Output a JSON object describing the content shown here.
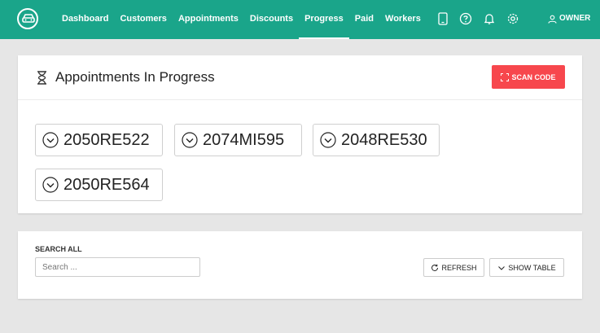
{
  "nav": {
    "links": [
      "Dashboard",
      "Customers",
      "Appointments",
      "Discounts",
      "Progress",
      "Paid",
      "Workers"
    ],
    "active": "Progress",
    "user_label": "OWNER",
    "icons": [
      "tablet-icon",
      "help-icon",
      "bell-icon",
      "gear-icon",
      "user-icon"
    ]
  },
  "progress_card": {
    "title": "Appointments In Progress",
    "scan_button": "SCAN CODE",
    "appointments": [
      "2050RE522",
      "2074MI595",
      "2048RE530",
      "2050RE564"
    ]
  },
  "search_card": {
    "label": "SEARCH ALL",
    "placeholder": "Search ...",
    "refresh_button": "REFRESH",
    "show_table_button": "SHOW TABLE"
  },
  "colors": {
    "nav_background": "#1aa58a",
    "scan_button": "#f7474d",
    "page_background": "#e6e6e6"
  }
}
